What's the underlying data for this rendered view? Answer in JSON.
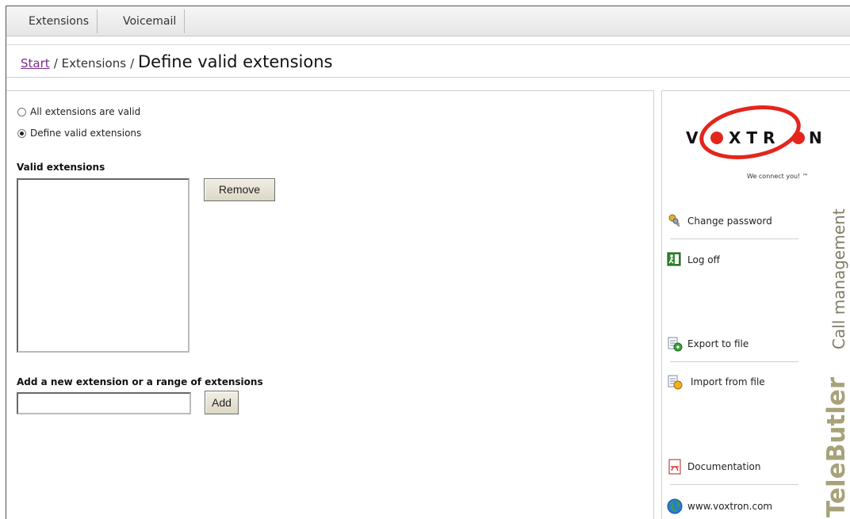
{
  "tabs": [
    {
      "label": "Extensions"
    },
    {
      "label": "Voicemail"
    }
  ],
  "breadcrumb": {
    "start": "Start",
    "separator": "/",
    "middle": "Extensions",
    "title": "Define valid extensions"
  },
  "form": {
    "radio_all": "All extensions are valid",
    "radio_define": "Define valid extensions",
    "selected_radio": "Define valid extensions",
    "valid_label": "Valid extensions",
    "remove_label": "Remove",
    "add_section_label": "Add a new extension or a range of extensions",
    "add_input_value": "",
    "add_label": "Add"
  },
  "sidebar": {
    "logo_text": "VOXTRON",
    "slogan": "We connect you! ™",
    "items": [
      {
        "label": "Change password",
        "icon": "keys-icon"
      },
      {
        "label": "Log off",
        "icon": "exit-icon"
      },
      {
        "label": "Export to file",
        "icon": "export-icon"
      },
      {
        "label": "Import from file",
        "icon": "import-icon"
      },
      {
        "label": "Documentation",
        "icon": "pdf-icon"
      },
      {
        "label": "www.voxtron.com",
        "icon": "globe-icon"
      }
    ],
    "vertical_brand": "TeleButler",
    "vertical_subtitle": "Call management"
  },
  "colors": {
    "link": "#7b2a8c",
    "logo_red": "#e3261d",
    "brand_olive": "#a8a27a"
  }
}
